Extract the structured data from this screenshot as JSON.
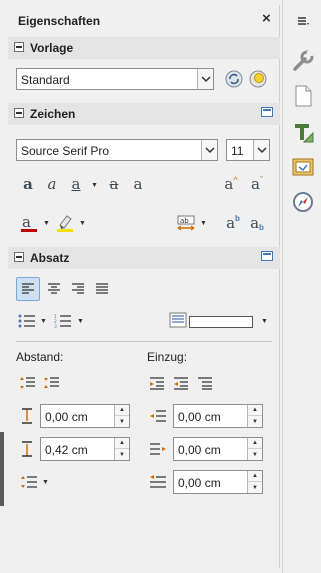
{
  "sidebar": {
    "title": "Eigenschaften",
    "close_label": "×",
    "vorlage": {
      "heading": "Vorlage",
      "style_value": "Standard"
    },
    "zeichen": {
      "heading": "Zeichen",
      "font_name": "Source Serif Pro",
      "font_size": "11",
      "shadow_label": "ab",
      "highlight_color": "#f2e000",
      "font_color": "#c00000"
    },
    "absatz": {
      "heading": "Absatz",
      "abstand_label": "Abstand:",
      "einzug_label": "Einzug:",
      "above_spacing": "0,00 cm",
      "below_spacing": "0,42 cm",
      "indent_before": "0,00 cm",
      "indent_after": "0,00 cm",
      "first_line_indent": "0,00 cm"
    }
  },
  "rail": {
    "menu_icon": "hamburger-icon",
    "items": [
      "properties-icon",
      "page-icon",
      "styles-icon",
      "gallery-icon",
      "navigator-icon"
    ]
  },
  "colors": {
    "accent": "#4a78b0",
    "panel_bg": "#f0f0f0"
  }
}
